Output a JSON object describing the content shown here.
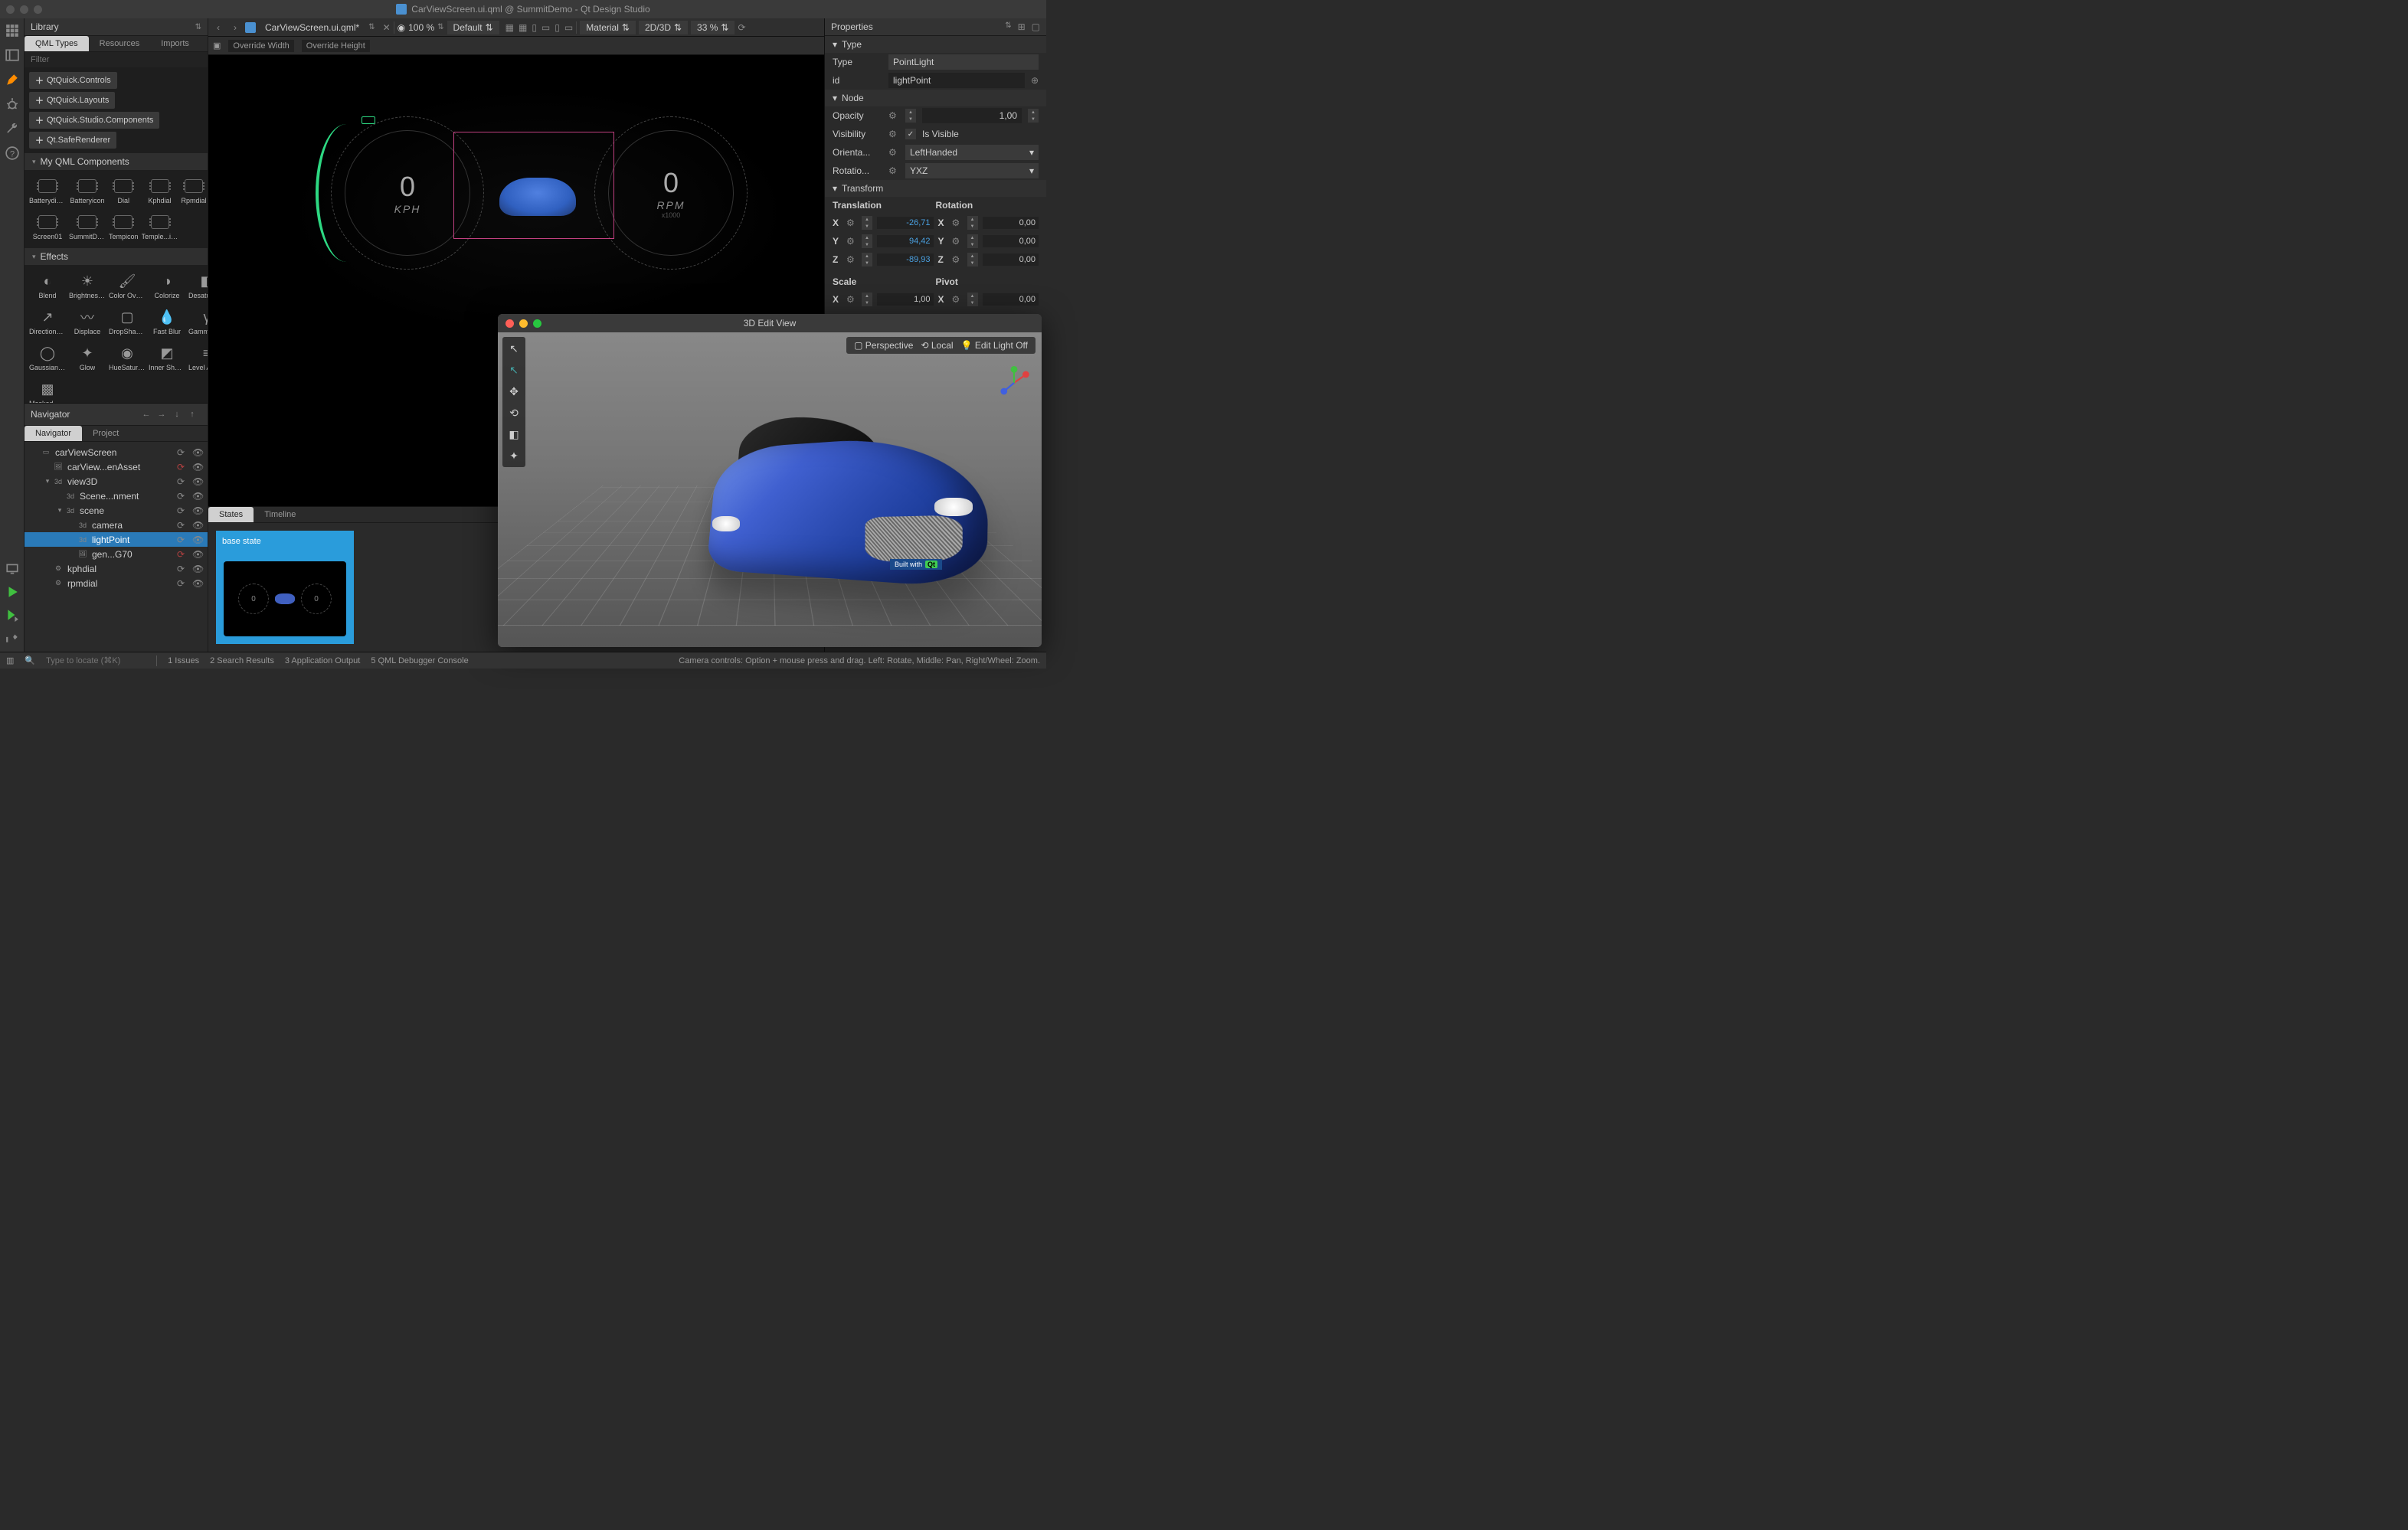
{
  "window": {
    "title": "CarViewScreen.ui.qml @ SummitDemo - Qt Design Studio"
  },
  "left_rail": {
    "icons": [
      "grid",
      "panel",
      "pencil",
      "bug",
      "wrench",
      "help"
    ],
    "bottom_icons": [
      "monitor",
      "play",
      "play-select",
      "hammer"
    ]
  },
  "library": {
    "title": "Library",
    "tabs": [
      "QML Types",
      "Resources",
      "Imports"
    ],
    "active_tab": 0,
    "filter_placeholder": "Filter",
    "chips": [
      "QtQuick.Controls",
      "QtQuick.Layouts",
      "QtQuick.Studio.Components",
      "Qt.SafeRenderer"
    ],
    "section1": {
      "title": "My QML Components",
      "items": [
        "Batterydisplay",
        "Batteryicon",
        "Dial",
        "Kphdial",
        "Rpmdial",
        "Screen01",
        "SummitDemo",
        "Tempicon",
        "Temple...isplay"
      ]
    },
    "section2": {
      "title": "Effects",
      "items": [
        "Blend",
        "Brightness Contrast",
        "Color Overlay",
        "Colorize",
        "Desaturation",
        "Directional Blur",
        "Displace",
        "DropShadow",
        "Fast Blur",
        "Gamma Adjust",
        "Gaussian Blur",
        "Glow",
        "HueSaturation",
        "Inner Shadow",
        "Level Adjust",
        "Masked Blur"
      ]
    }
  },
  "navigator": {
    "title": "Navigator",
    "tabs": [
      "Navigator",
      "Project"
    ],
    "active_tab": 0,
    "tree": [
      {
        "depth": 0,
        "icon": "rect",
        "label": "carViewScreen",
        "caret": "",
        "red": false
      },
      {
        "depth": 1,
        "icon": "img",
        "label": "carView...enAsset",
        "caret": "",
        "red": true
      },
      {
        "depth": 1,
        "icon": "3d",
        "label": "view3D",
        "caret": "▾",
        "red": false
      },
      {
        "depth": 2,
        "icon": "3d",
        "label": "Scene...nment",
        "caret": "",
        "red": false
      },
      {
        "depth": 2,
        "icon": "3d",
        "label": "scene",
        "caret": "▾",
        "red": false
      },
      {
        "depth": 3,
        "icon": "3d",
        "label": "camera",
        "caret": "",
        "red": false
      },
      {
        "depth": 3,
        "icon": "3d",
        "label": "lightPoint",
        "caret": "",
        "red": false,
        "selected": true
      },
      {
        "depth": 3,
        "icon": "img",
        "label": "gen...G70",
        "caret": "",
        "red": true
      },
      {
        "depth": 1,
        "icon": "gear",
        "label": "kphdial",
        "caret": "",
        "red": false
      },
      {
        "depth": 1,
        "icon": "gear",
        "label": "rpmdial",
        "caret": "",
        "red": false
      }
    ]
  },
  "document": {
    "open_file": "CarViewScreen.ui.qml*",
    "zoom": "100 %",
    "style": "Default",
    "material": "Material",
    "view_mode": "2D/3D",
    "pct": "33 %",
    "override_width": "Override Width",
    "override_height": "Override Height"
  },
  "canvas": {
    "kph_value": "0",
    "kph_label": "KPH",
    "rpm_value": "0",
    "rpm_label": "RPM",
    "rpm_sub": "x1000"
  },
  "states": {
    "tabs": [
      "States",
      "Timeline"
    ],
    "active_tab": 0,
    "base": "base state",
    "thumb_left": "0",
    "thumb_right": "0"
  },
  "view3d": {
    "title": "3D Edit View",
    "perspective": "Perspective",
    "local": "Local",
    "light": "Edit Light Off",
    "plate_text": "Built with",
    "plate_badge": "Qt"
  },
  "properties": {
    "title": "Properties",
    "type_section": "Type",
    "type_label": "Type",
    "type_value": "PointLight",
    "id_label": "id",
    "id_value": "lightPoint",
    "node_section": "Node",
    "opacity_label": "Opacity",
    "opacity_value": "1,00",
    "visibility_label": "Visibility",
    "visibility_value": "Is Visible",
    "orientation_label": "Orienta...",
    "orientation_value": "LeftHanded",
    "rotation_order_label": "Rotatio...",
    "rotation_order_value": "YXZ",
    "transform_section": "Transform",
    "translation_label": "Translation",
    "rotation_label": "Rotation",
    "t_x": "-26,71",
    "t_y": "94,42",
    "t_z": "-89,93",
    "r_x": "0,00",
    "r_y": "0,00",
    "r_z": "0,00",
    "scale_label": "Scale",
    "pivot_label": "Pivot",
    "s_x": "1,00",
    "p_x": "0,00"
  },
  "statusbar": {
    "locate_placeholder": "Type to locate (⌘K)",
    "items": [
      "1  Issues",
      "2  Search Results",
      "3  Application Output",
      "5  QML Debugger Console"
    ],
    "camera_hint": "Camera controls: Option + mouse press and drag. Left: Rotate, Middle: Pan, Right/Wheel: Zoom."
  }
}
